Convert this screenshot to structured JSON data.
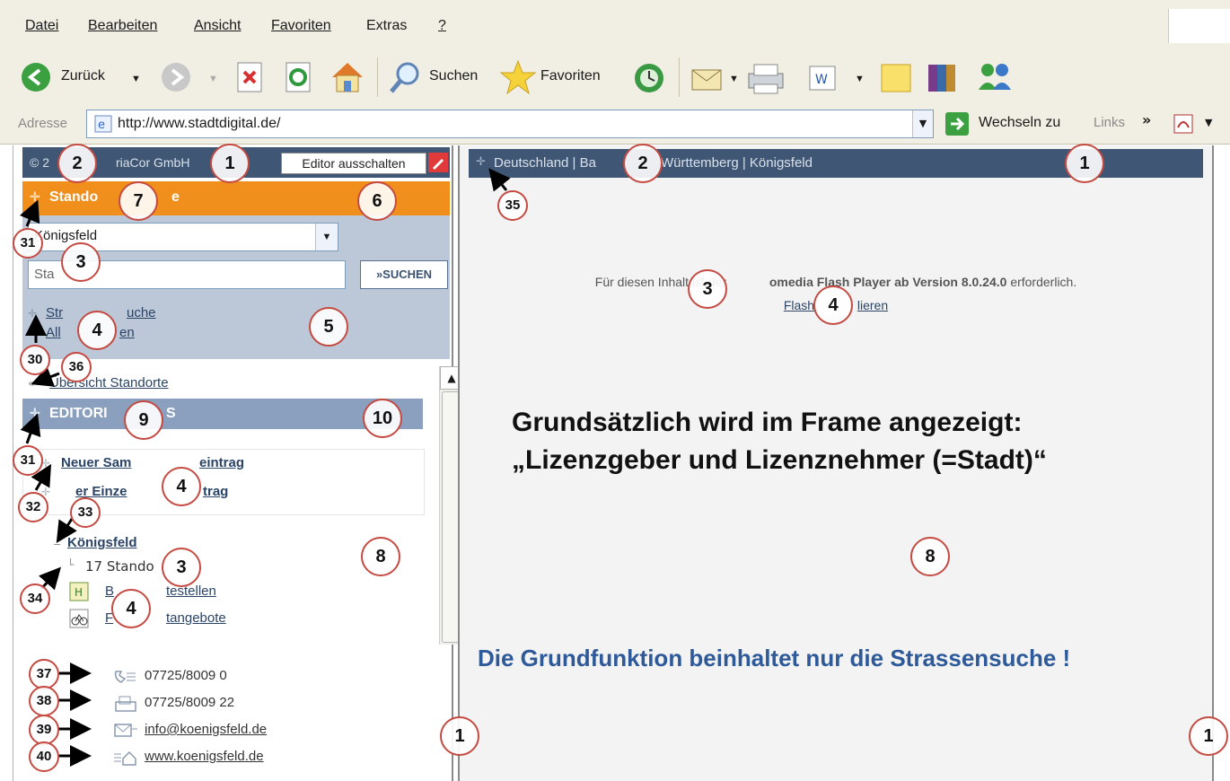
{
  "menubar": {
    "items": [
      "Datei",
      "Bearbeiten",
      "Ansicht",
      "Favoriten",
      "Extras",
      "?"
    ]
  },
  "toolbar": {
    "back_label": "Zurück",
    "search_label": "Suchen",
    "favorites_label": "Favoriten"
  },
  "addressbar": {
    "label": "Adresse",
    "url": "http://www.stadtdigital.de/",
    "go_label": "Wechseln zu",
    "links_label": "Links"
  },
  "left": {
    "header_text": "© 2",
    "company": "riaCor GmbH",
    "editor_button": "Editor ausschalten",
    "standort_header": "Stando",
    "standort_header_tail": "e",
    "location_value": "Königsfeld",
    "search_placeholder": "Sta",
    "search_button": "»SUCHEN",
    "link_strassen": "Str",
    "link_strassen_tail": "uche",
    "link_alle": "All",
    "link_alle_tail": "en",
    "overview_link": "Übersicht Standorte",
    "editor_header": "EDITORI",
    "editor_header_tail": "S",
    "new_collective": "Neuer Sam",
    "new_collective_tail": "eintrag",
    "new_single": "er Einze",
    "new_single_tail": "trag",
    "tree_root": "Königsfeld",
    "tree_count": "17 Stando",
    "item1": "B",
    "item1_tail": "testellen",
    "item2": "F",
    "item2_tail": "tangebote",
    "phone": "07725/8009 0",
    "fax": "07725/8009 22",
    "email": "info@koenigsfeld.de",
    "web": "www.koenigsfeld.de"
  },
  "right": {
    "breadcrumb_a": "Deutschland | Ba",
    "breadcrumb_b": "Württemberg | Königsfeld",
    "flash_msg_a": "Für diesen Inhalt ist der",
    "flash_msg_b": "omedia Flash Player ab Version 8.0.24.0",
    "flash_msg_c": "erforderlich.",
    "flash_link_a": "Flash",
    "flash_link_b": "lieren",
    "overlay_line1": "Grundsätzlich wird im Frame angezeigt:",
    "overlay_line2": "„Lizenzgeber und Lizenznehmer (=Stadt)“",
    "overlay_line3": "Die Grundfunktion beinhaltet nur die Strassensuche !"
  },
  "callouts": {
    "c1": "1",
    "c2": "2",
    "c3": "3",
    "c4": "4",
    "c5": "5",
    "c6": "6",
    "c7": "7",
    "c8": "8",
    "c9": "9",
    "c10": "10",
    "c30": "30",
    "c31": "31",
    "c32": "32",
    "c33": "33",
    "c34": "34",
    "c35": "35",
    "c36": "36",
    "c37": "37",
    "c38": "38",
    "c39": "39",
    "c40": "40"
  },
  "colors": {
    "chrome_bg": "#f1efe4",
    "frame_header": "#3f5774",
    "orange_header": "#f18f1c",
    "panel_blue": "#bcc8d8",
    "callout_ring": "#c44a42",
    "overlay_blue": "#2f5a9a"
  }
}
